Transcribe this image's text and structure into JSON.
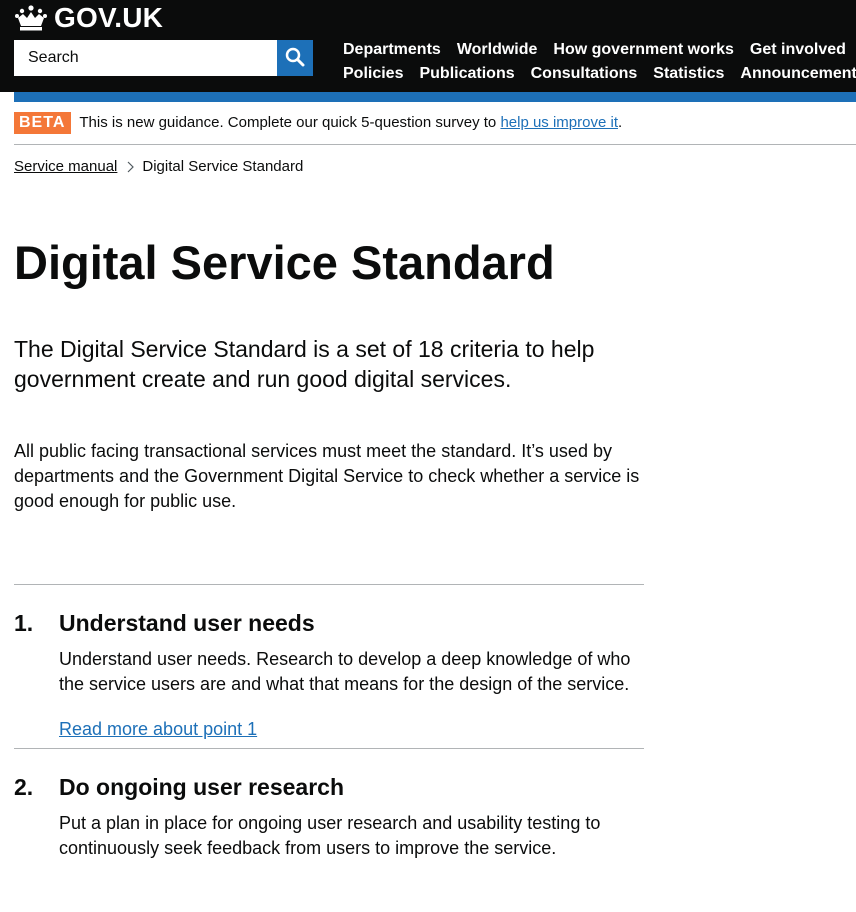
{
  "header": {
    "logo_text": "GOV.UK",
    "search": {
      "placeholder": "Search",
      "button_icon": "search-icon"
    },
    "nav": {
      "row1": [
        "Departments",
        "Worldwide",
        "How government works",
        "Get involved"
      ],
      "row2": [
        "Policies",
        "Publications",
        "Consultations",
        "Statistics",
        "Announcements"
      ]
    },
    "colors": {
      "header_bg": "#0b0c0c",
      "accent_blue": "#1d70b8",
      "beta_orange": "#f47738"
    }
  },
  "phase": {
    "tag": "BETA",
    "text": "This is new guidance. Complete our quick 5-question survey to",
    "link": "help us improve it",
    "after_link": "."
  },
  "breadcrumbs": {
    "parent": "Service manual",
    "current": "Digital Service Standard"
  },
  "page": {
    "title": "Digital Service Standard",
    "lead": "The Digital Service Standard is a set of 18 criteria to help government create and run good digital services.",
    "body": "All public facing transactional services must meet the standard. It’s used by departments and the Government Digital Service to check whether a service is good enough for public use."
  },
  "criteria": [
    {
      "number": "1.",
      "title": "Understand user needs",
      "description": "Understand user needs. Research to develop a deep knowledge of who the service users are and what that means for the design of the service.",
      "link": "Read more about point 1"
    },
    {
      "number": "2.",
      "title": "Do ongoing user research",
      "description": "Put a plan in place for ongoing user research and usability testing to continuously seek feedback from users to improve the service.",
      "link": ""
    }
  ]
}
